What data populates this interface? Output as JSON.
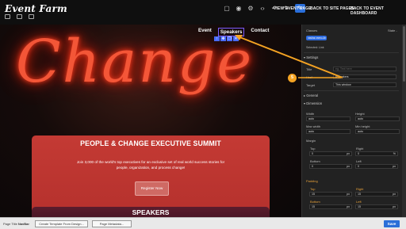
{
  "topbar": {
    "logo": "Event Farm",
    "links": [
      "VIEW EVENT PAGE",
      "BACK TO SITE PAGES",
      "BACK TO EVENT DASHBOARD"
    ],
    "icons": [
      "desktop-icon",
      "tablet-icon",
      "mobile-icon",
      "square-icon",
      "eye-icon",
      "settings-icon",
      "code-icon",
      "undo-icon",
      "redo-icon",
      "brush-icon"
    ]
  },
  "canvas": {
    "neon_text": "Change",
    "nav": [
      "Event",
      "Speakers",
      "Contact"
    ],
    "summit_title": "PEOPLE & CHANGE EXECUTIVE SUMMIT",
    "summit_body": "Join 3,000 of the world's top executives for an exclusive set of real world success stories for people, organization, and process change!",
    "register_label": "Register Now",
    "speakers_title": "SPEAKERS"
  },
  "panel": {
    "classes_label": "Classes",
    "state_label": "State -",
    "chip_label": "navbar-menu-lin",
    "selected_label": "Selected: Link",
    "settings_label": "Settings",
    "title_label": "Title",
    "title_placeholder": "eg. Text here",
    "href_label": "Href",
    "href_value": "#speakers",
    "target_label": "Target",
    "target_value": "This window",
    "general_label": "General",
    "dimension_label": "Dimension",
    "width_label": "Width",
    "width_value": "auto",
    "height_label": "Height",
    "height_value": "auto",
    "max_width_label": "Max width",
    "max_width_value": "auto",
    "min_height_label": "Min height",
    "min_height_value": "auto",
    "margin_label": "Margin",
    "top_label": "Top",
    "right_label": "Right",
    "bottom_label": "Bottom",
    "left_label": "Left",
    "margin_top": "0",
    "margin_right": "0",
    "margin_bottom": "0",
    "margin_left": "0",
    "padding_label": "Padding",
    "pad_top": "15",
    "pad_right": "15",
    "pad_bottom": "15",
    "pad_left": "15",
    "unit_px": "px",
    "unit_pct": "%"
  },
  "bottombar": {
    "page_title_label": "Page Title",
    "page_title_value": "NavBar",
    "create_template_label": "Create Template From Design...",
    "page_metadata_label": "Page Metadata...",
    "save_label": "Save"
  },
  "annotation": {
    "step_number": "5"
  },
  "colors": {
    "accent": "#2b6fd8",
    "summit_bg": "#c43a34",
    "annotation": "#f4a323",
    "selection": "#7b5cff"
  }
}
